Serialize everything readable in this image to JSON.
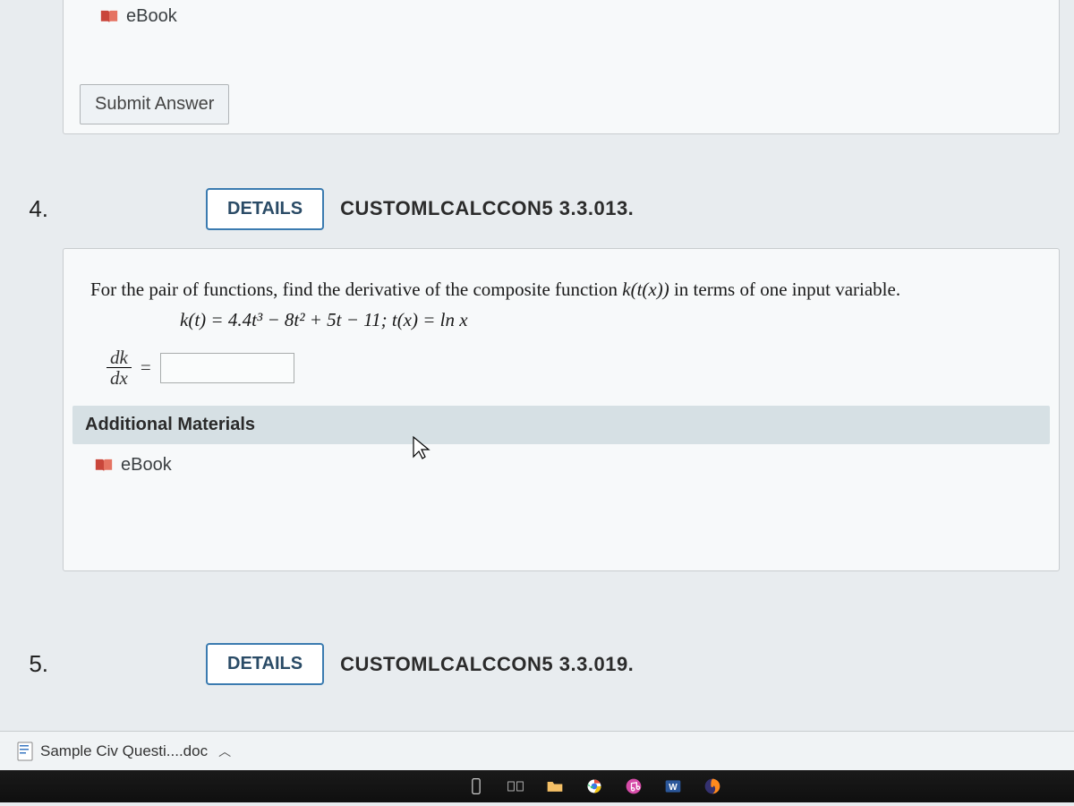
{
  "top_card": {
    "ebook_label": "eBook",
    "submit_label": "Submit Answer"
  },
  "q4": {
    "number": "4.",
    "details_label": "DETAILS",
    "problem_id": "CUSTOMLCALCCON5 3.3.013.",
    "prompt_lead": "For the pair of functions, find the derivative of the composite function ",
    "prompt_fn": "k(t(x))",
    "prompt_tail": " in terms of one input variable.",
    "formula": "k(t) = 4.4t³ − 8t² + 5t − 11;  t(x) = ln x",
    "deriv_num": "dk",
    "deriv_den": "dx",
    "equals": "=",
    "answer_value": "",
    "additional_materials": "Additional Materials",
    "ebook_label": "eBook"
  },
  "q5": {
    "number": "5.",
    "details_label": "DETAILS",
    "problem_id": "CUSTOMLCALCCON5 3.3.019."
  },
  "download_bar": {
    "file_name": "Sample Civ Questi....doc"
  },
  "taskbar": {
    "icons": [
      "phone",
      "task-view",
      "explorer",
      "chrome",
      "itunes",
      "word",
      "firefox"
    ]
  }
}
